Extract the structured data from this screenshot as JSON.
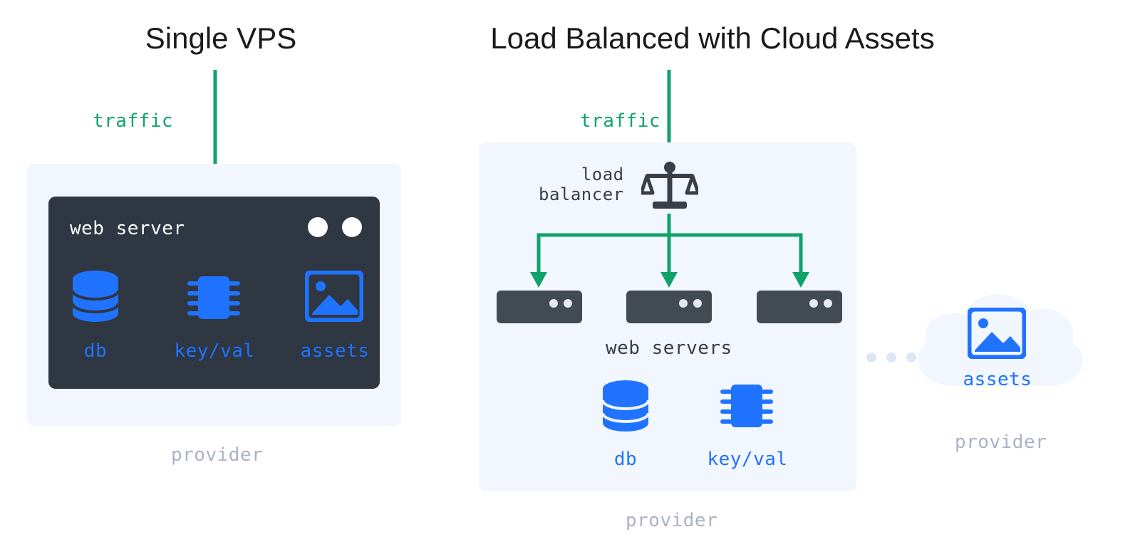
{
  "colors": {
    "accent_green": "#0fa36b",
    "accent_blue": "#2073ff",
    "panel_bg": "#f2f7ff",
    "server_bg": "#2e3742",
    "mini_server_bg": "#424a54",
    "muted": "#a9b3c6"
  },
  "left": {
    "title": "Single VPS",
    "traffic_label": "traffic",
    "provider_label": "provider",
    "server": {
      "label": "web server",
      "services": {
        "db": "db",
        "keyval": "key/val",
        "assets": "assets"
      }
    }
  },
  "right": {
    "title": "Load Balanced with Cloud Assets",
    "traffic_label": "traffic",
    "provider_label": "provider",
    "load_balancer_label": "load\nbalancer",
    "web_servers_label": "web servers",
    "services": {
      "db": "db",
      "keyval": "key/val"
    },
    "cloud": {
      "assets_label": "assets",
      "provider_label": "provider"
    }
  }
}
